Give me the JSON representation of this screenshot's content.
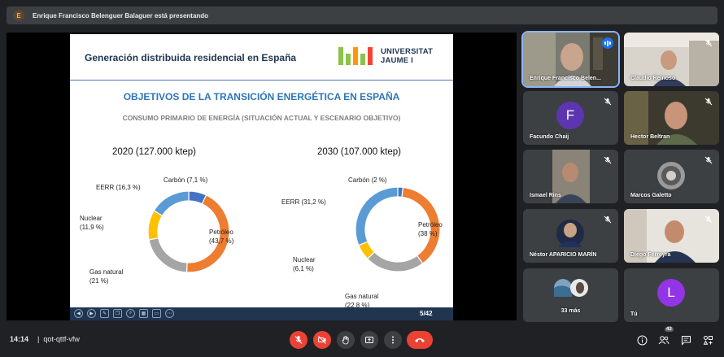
{
  "banner": {
    "avatar_letter": "E",
    "text": "Enrique Francisco Belenguer Balaguer está presentando"
  },
  "slide": {
    "title": "Generación distribuida residencial en España",
    "logo_line1": "UNIVERSITAT",
    "logo_line2": "JAUME I",
    "headline": "OBJETIVOS DE LA TRANSICIÓN ENERGÉTICA EN ESPAÑA",
    "subheadline": "CONSUMO PRIMARIO DE ENERGÍA (SITUACIÓN ACTUAL Y ESCENARIO OBJETIVO)",
    "page": "5/42"
  },
  "chart_data": [
    {
      "type": "pie",
      "title": "2020 (127.000 ktep)",
      "categories": [
        "Carbón",
        "Petróleo",
        "Gas natural",
        "Nuclear",
        "EERR"
      ],
      "values": [
        7.1,
        43.7,
        21,
        11.9,
        16.3
      ],
      "labels": [
        [
          "Carbón (7,1 %)"
        ],
        [
          "Petróleo",
          "(43,7 %)"
        ],
        [
          "Gas natural",
          "(21 %)"
        ],
        [
          "Nuclear",
          "(11,9 %)"
        ],
        [
          "EERR (16,3 %)"
        ]
      ],
      "colors": [
        "#4472c4",
        "#ed7d31",
        "#a5a5a5",
        "#ffc000",
        "#5b9bd5"
      ],
      "style": "donut"
    },
    {
      "type": "pie",
      "title": "2030 (107.000 ktep)",
      "categories": [
        "Carbón",
        "Petróleo",
        "Gas natural",
        "Nuclear",
        "EERR"
      ],
      "values": [
        2,
        38,
        22.8,
        6.1,
        31.2
      ],
      "labels": [
        [
          "Carbón (2 %)"
        ],
        [
          "Petróleo",
          "(38 %)"
        ],
        [
          "Gas natural",
          "(22,8 %)"
        ],
        [
          "Nuclear",
          "(6,1 %)"
        ],
        [
          "EERR (31,2 %)"
        ]
      ],
      "colors": [
        "#4472c4",
        "#ed7d31",
        "#a5a5a5",
        "#ffc000",
        "#5b9bd5"
      ],
      "style": "donut"
    }
  ],
  "participants": [
    {
      "name": "Enrique Francisco Belen...",
      "type": "video",
      "active": true
    },
    {
      "name": "Claudio Reinoso",
      "type": "video"
    },
    {
      "name": "Facundo Chaij",
      "type": "letter",
      "letter": "F",
      "color": "#5e35b1"
    },
    {
      "name": "Hector Beltran",
      "type": "video"
    },
    {
      "name": "Ismael Rins",
      "type": "video"
    },
    {
      "name": "Marcos Galetto",
      "type": "video"
    },
    {
      "name": "Néstor APARICIO MARÍN",
      "type": "video"
    },
    {
      "name": "Diego Ferreyra",
      "type": "video"
    },
    {
      "name": "33 más",
      "type": "more"
    },
    {
      "name": "Tú",
      "type": "letter",
      "letter": "L",
      "color": "#9334e6"
    }
  ],
  "bottom": {
    "time": "14:14",
    "separator": "|",
    "meeting_code": "qot-qttf-vfw",
    "participant_count": "43"
  }
}
